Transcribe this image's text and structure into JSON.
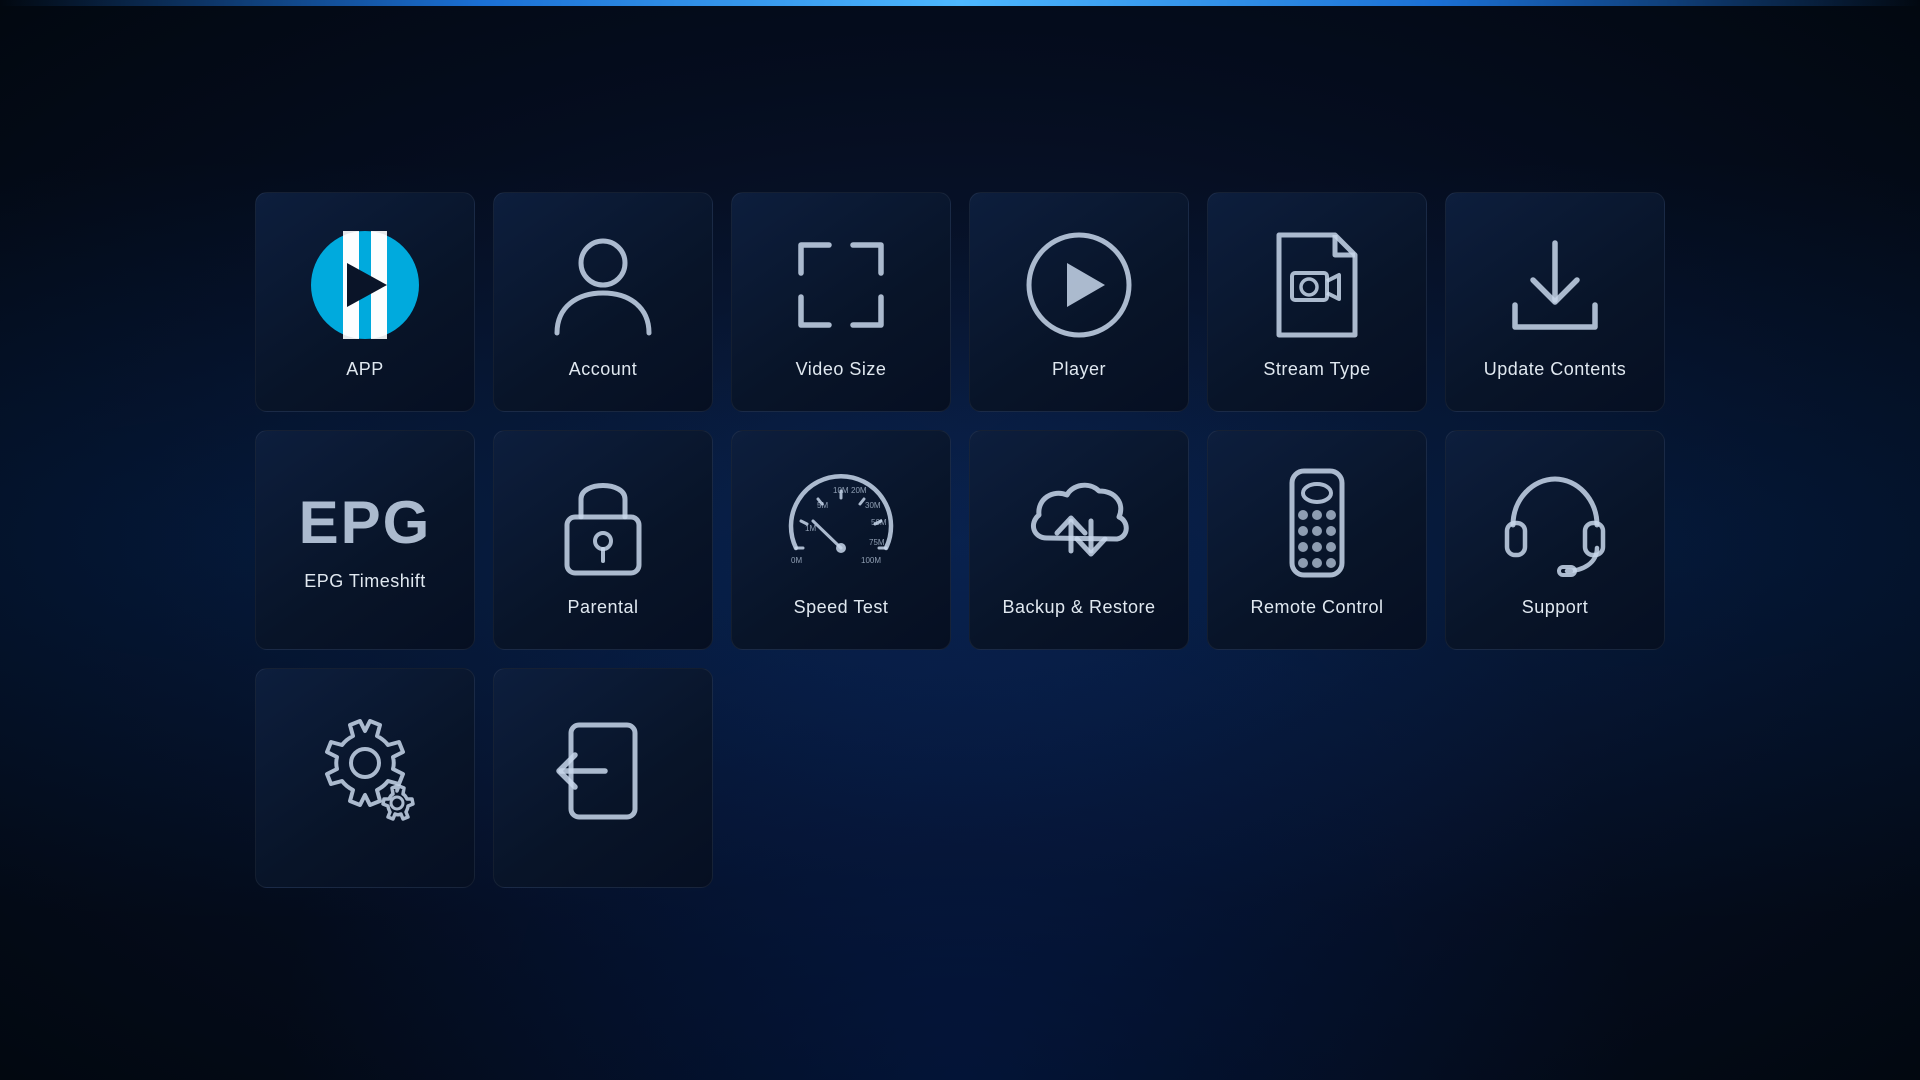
{
  "tiles": [
    {
      "id": "app",
      "label": "APP",
      "type": "app"
    },
    {
      "id": "account",
      "label": "Account",
      "type": "account"
    },
    {
      "id": "video-size",
      "label": "Video Size",
      "type": "video-size"
    },
    {
      "id": "player",
      "label": "Player",
      "type": "player"
    },
    {
      "id": "stream-type",
      "label": "Stream Type",
      "type": "stream-type"
    },
    {
      "id": "update-contents",
      "label": "Update Contents",
      "type": "update-contents"
    },
    {
      "id": "epg-timeshift",
      "label": "EPG Timeshift",
      "type": "epg"
    },
    {
      "id": "parental",
      "label": "Parental",
      "type": "parental"
    },
    {
      "id": "speed-test",
      "label": "Speed Test",
      "type": "speed-test"
    },
    {
      "id": "backup-restore",
      "label": "Backup & Restore",
      "type": "backup-restore"
    },
    {
      "id": "remote-control",
      "label": "Remote Control",
      "type": "remote-control"
    },
    {
      "id": "support",
      "label": "Support",
      "type": "support"
    },
    {
      "id": "settings",
      "label": "",
      "type": "settings"
    },
    {
      "id": "exit",
      "label": "",
      "type": "exit"
    }
  ]
}
